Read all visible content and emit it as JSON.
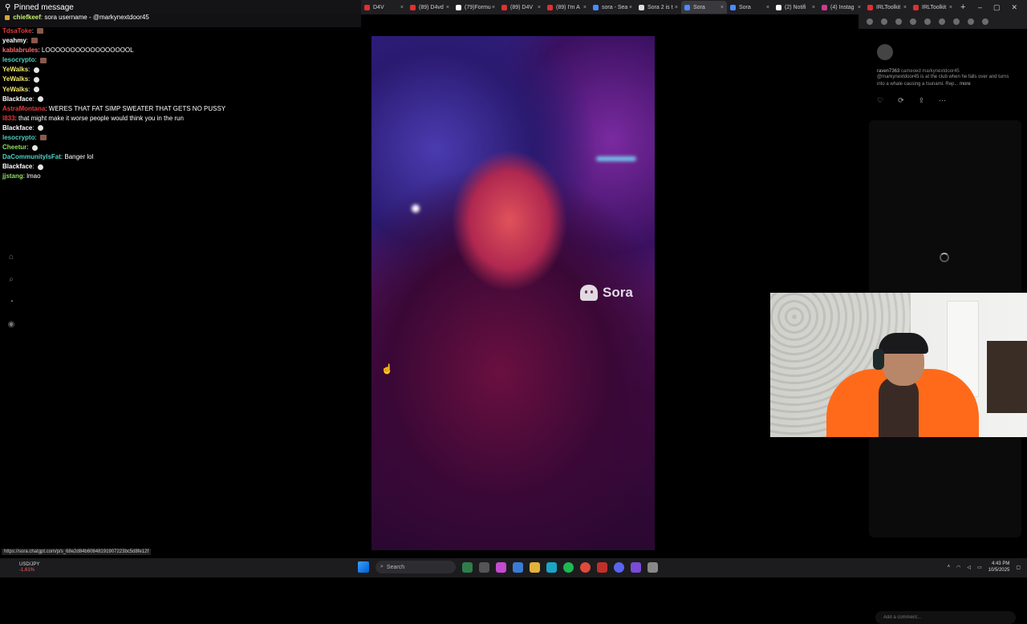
{
  "browser": {
    "tabs": [
      {
        "title": "D4V",
        "color": "#e03030"
      },
      {
        "title": "(89) D4vd",
        "color": "#e03030"
      },
      {
        "title": "(79)Formu",
        "color": "#ffffff"
      },
      {
        "title": "(89) D4V",
        "color": "#e03030"
      },
      {
        "title": "(89) I'm A",
        "color": "#e03030"
      },
      {
        "title": "sora - Sea",
        "color": "#4a8cff"
      },
      {
        "title": "Sora 2 is t",
        "color": "#dddddd"
      },
      {
        "title": "Sora",
        "color": "#4a8cff",
        "active": true
      },
      {
        "title": "Sora",
        "color": "#4a8cff"
      },
      {
        "title": "(2) Notifi",
        "color": "#ffffff"
      },
      {
        "title": "(4) Instag",
        "color": "#d03a8a"
      },
      {
        "title": "IRLToolkit",
        "color": "#e03030"
      },
      {
        "title": "IRLToolkit",
        "color": "#e03030"
      }
    ],
    "new_tab": "+",
    "window_controls": [
      "–",
      "▢",
      "✕"
    ]
  },
  "pinned": {
    "title": "Pinned message",
    "user": "chiefkeef",
    "text": "sora username - @markynextdoor45"
  },
  "chat": [
    {
      "user": "TdsaToke",
      "color": "#e23b3b",
      "text": "",
      "emote": "brown"
    },
    {
      "user": "yeahmy",
      "color": "#ffffff",
      "text": "",
      "emote": "brown"
    },
    {
      "user": "kablabrules",
      "color": "#ff6b6b",
      "text": "LOOOOOOOOOOOOOOOOOL",
      "emote": ""
    },
    {
      "user": "lesocrypto",
      "color": "#4fd1c5",
      "text": "",
      "emote": "brown"
    },
    {
      "user": "YeWalks",
      "color": "#f2e56b",
      "text": "",
      "emote": "round"
    },
    {
      "user": "YeWalks",
      "color": "#f2e56b",
      "text": "",
      "emote": "round"
    },
    {
      "user": "YeWalks",
      "color": "#f2e56b",
      "text": "",
      "emote": "round"
    },
    {
      "user": "Blackface",
      "color": "#ffffff",
      "text": "",
      "emote": "round"
    },
    {
      "user": "AstraMontana",
      "color": "#e23b3b",
      "text": "WERES THAT FAT SIMP SWEATER THAT GETS NO PUSSY",
      "emote": ""
    },
    {
      "user": "l833",
      "color": "#e23b3b",
      "text": "that might make it worse people would think you in the run",
      "emote": ""
    },
    {
      "user": "Blackface",
      "color": "#ffffff",
      "text": "",
      "emote": "round"
    },
    {
      "user": "lesocrypto",
      "color": "#4fd1c5",
      "text": "",
      "emote": "brown"
    },
    {
      "user": "Cheetur",
      "color": "#8ee05c",
      "text": "",
      "emote": "round"
    },
    {
      "user": "DaCommunityIsFat",
      "color": "#4fd1c5",
      "text": "Banger lol",
      "emote": ""
    },
    {
      "user": "Blackface",
      "color": "#ffffff",
      "text": "",
      "emote": "round"
    },
    {
      "user": "jjstang",
      "color": "#8ee05c",
      "text": "lmao",
      "emote": ""
    }
  ],
  "leftnav": [
    {
      "name": "home-icon",
      "glyph": "⌂"
    },
    {
      "name": "search-icon",
      "glyph": "⌕"
    },
    {
      "name": "bell-icon",
      "glyph": "◔"
    },
    {
      "name": "profile-icon",
      "glyph": "◉"
    }
  ],
  "video": {
    "watermark": "Sora"
  },
  "post": {
    "username": "raven7363",
    "remix_text": "cameoed markynextdoor45",
    "caption": "@markynextdoor45 is at the club when he falls over and turns into a whale causing a tsunami. Rep...",
    "more": "more",
    "comment_placeholder": "Add a comment..."
  },
  "status_url": "https://sora.chatgpt.com/p/s_68e2d84b60848191907223bc5d8fe12f",
  "taskbar": {
    "ticker_name": "USD/JPY",
    "ticker_change": "-1.61%",
    "search_label": "Search",
    "time": "4:43 PM",
    "date": "10/5/2025"
  }
}
